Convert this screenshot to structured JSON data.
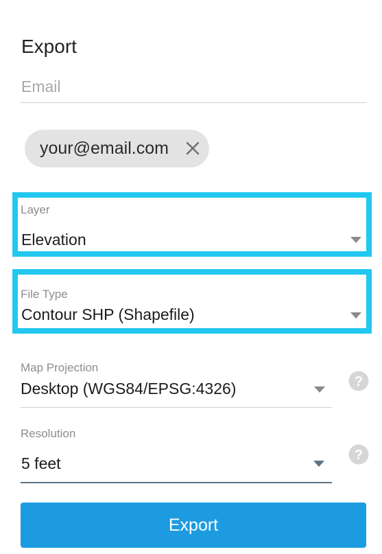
{
  "panel": {
    "title": "Export"
  },
  "email": {
    "placeholder": "Email",
    "value": "",
    "chip": "your@email.com"
  },
  "layer": {
    "label": "Layer",
    "value": "Elevation"
  },
  "file_type": {
    "label": "File Type",
    "value": "Contour SHP (Shapefile)"
  },
  "projection": {
    "label": "Map Projection",
    "value": "Desktop (WGS84/EPSG:4326)"
  },
  "resolution": {
    "label": "Resolution",
    "value": "5 feet"
  },
  "export_button": {
    "label": "Export"
  },
  "icons": {
    "chip_close": "close-icon",
    "dropdown": "chevron-down-icon",
    "help": "question-circle-icon"
  },
  "colors": {
    "highlight": "#22c8f0",
    "primary_button": "#1d9be0",
    "chip_background": "#e3e3e3",
    "active_underline": "#5c7383"
  }
}
